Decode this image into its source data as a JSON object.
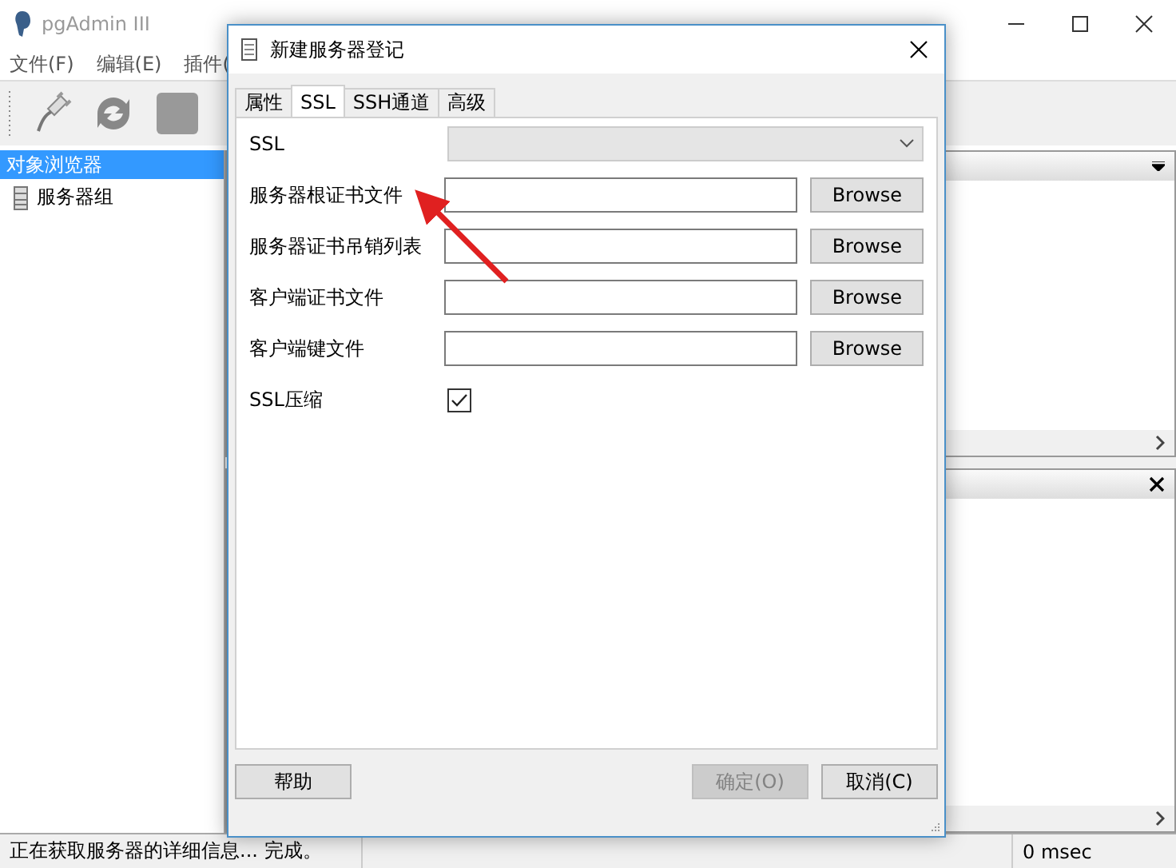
{
  "main_window": {
    "title": "pgAdmin III",
    "menu": [
      "文件(F)",
      "编辑(E)",
      "插件("
    ],
    "object_browser": {
      "title": "对象浏览器",
      "items": [
        {
          "label": "服务器组"
        }
      ]
    },
    "status_bar": {
      "message": "正在获取服务器的详细信息... 完成。",
      "time": "0 msec"
    }
  },
  "dialog": {
    "title": "新建服务器登记",
    "tabs": [
      {
        "label": "属性",
        "selected": false
      },
      {
        "label": "SSL",
        "selected": true
      },
      {
        "label": "SSH通道",
        "selected": false
      },
      {
        "label": "高级",
        "selected": false
      }
    ],
    "ssl_mode": {
      "label": "SSL"
    },
    "file_fields": [
      {
        "label": "服务器根证书文件",
        "button": "Browse"
      },
      {
        "label": "服务器证书吊销列表",
        "button": "Browse"
      },
      {
        "label": "客户端证书文件",
        "button": "Browse"
      },
      {
        "label": "客户端键文件",
        "button": "Browse"
      }
    ],
    "compression": {
      "label": "SSL压缩",
      "checked": true
    },
    "buttons": [
      {
        "label": "帮助",
        "disabled": false
      },
      {
        "label": "确定(O)",
        "disabled": true
      },
      {
        "label": "取消(C)",
        "disabled": false
      }
    ]
  }
}
